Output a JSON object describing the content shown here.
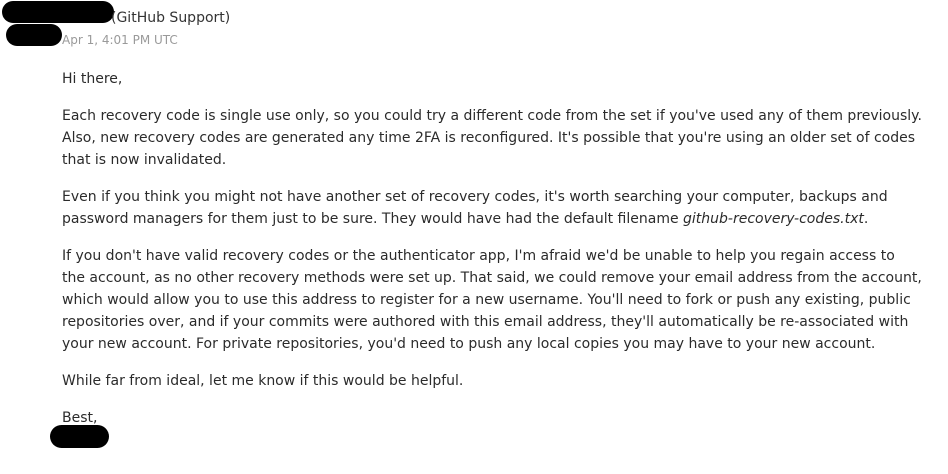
{
  "sender": {
    "label": "(GitHub Support)",
    "timestamp": "Apr 1, 4:01 PM UTC"
  },
  "message": {
    "greeting": "Hi there,",
    "paragraph_1": "Each recovery code is single use only, so you could try a different code from the set if you've used any of them previously. Also, new recovery codes are generated any time 2FA is reconfigured. It's possible that you're using an older set of codes that is now invalidated.",
    "paragraph_2_text": "Even if you think you might not have another set of recovery codes, it's worth searching your computer, backups and password managers for them just to be sure. They would have had the default filename ",
    "paragraph_2_filename": "github-recovery-codes.txt",
    "paragraph_2_end": ".",
    "paragraph_3": "If you don't have valid recovery codes or the authenticator app, I'm afraid we'd be unable to help you regain access to the account, as no other recovery methods were set up. That said, we could remove your email address from the account, which would allow you to use this address to register for a new username. You'll need to fork or push any existing, public repositories over, and if your commits were authored with this email address, they'll automatically be re-associated with your new account. For private repositories, you'd need to push any local copies you may have to your new account.",
    "paragraph_4": "While far from ideal, let me know if this would be helpful.",
    "signoff": "Best,"
  }
}
